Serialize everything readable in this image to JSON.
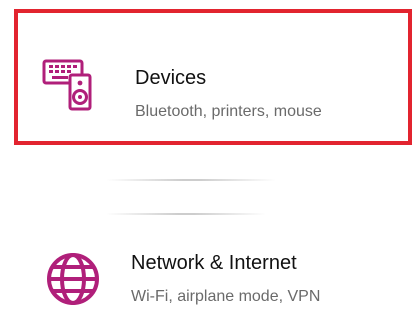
{
  "settings": {
    "items": [
      {
        "title": "Devices",
        "subtitle": "Bluetooth, printers, mouse",
        "icon": "devices-icon",
        "highlighted": true
      },
      {
        "title": "Network & Internet",
        "subtitle": "Wi-Fi, airplane mode, VPN",
        "icon": "globe-icon",
        "highlighted": false
      }
    ]
  },
  "colors": {
    "accent": "#b01f7a",
    "highlight_border": "#e2242f",
    "title_text": "#111111",
    "subtitle_text": "#6a6a6a"
  }
}
